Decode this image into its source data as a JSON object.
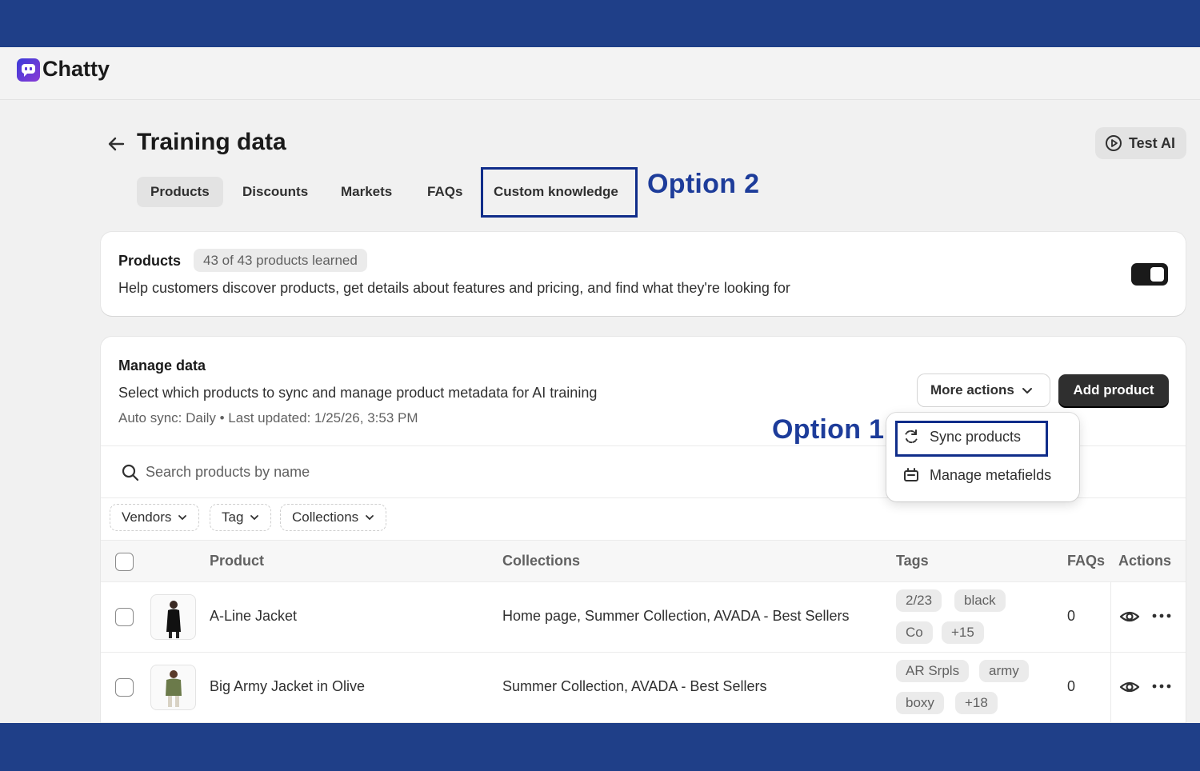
{
  "app": {
    "name": "Chatty"
  },
  "header": {
    "title": "Training data",
    "test_ai_label": "Test AI"
  },
  "tabs": [
    {
      "label": "Products",
      "active": true
    },
    {
      "label": "Discounts"
    },
    {
      "label": "Markets"
    },
    {
      "label": "FAQs"
    },
    {
      "label": "Custom knowledge"
    }
  ],
  "annotations": {
    "option1": "Option 1",
    "option2": "Option 2",
    "color": "#1d3c9a"
  },
  "products_card": {
    "title": "Products",
    "badge": "43 of 43 products learned",
    "description": "Help customers discover products, get details about features and pricing, and find what they're looking for",
    "toggle_on": true
  },
  "manage_card": {
    "title": "Manage data",
    "description": "Select which products to sync and manage product metadata for AI training",
    "meta": "Auto sync: Daily • Last updated: 1/25/26, 3:53 PM",
    "more_actions_label": "More actions",
    "add_product_label": "Add product",
    "search_placeholder": "Search products by name",
    "filters": [
      "Vendors",
      "Tag",
      "Collections"
    ]
  },
  "menu": {
    "items": [
      "Sync products",
      "Manage metafields"
    ]
  },
  "table": {
    "headers": {
      "product": "Product",
      "collections": "Collections",
      "tags": "Tags",
      "faqs": "FAQs",
      "actions": "Actions"
    },
    "rows": [
      {
        "product": "A-Line Jacket",
        "collections": "Home page, Summer Collection, AVADA - Best Sellers",
        "tags": [
          "2/23",
          "black",
          "Co",
          "+15"
        ],
        "faqs": "0"
      },
      {
        "product": "Big Army Jacket in Olive",
        "collections": "Summer Collection, AVADA - Best Sellers",
        "tags": [
          "AR Srpls",
          "army",
          "boxy",
          "+18"
        ],
        "faqs": "0"
      }
    ]
  }
}
